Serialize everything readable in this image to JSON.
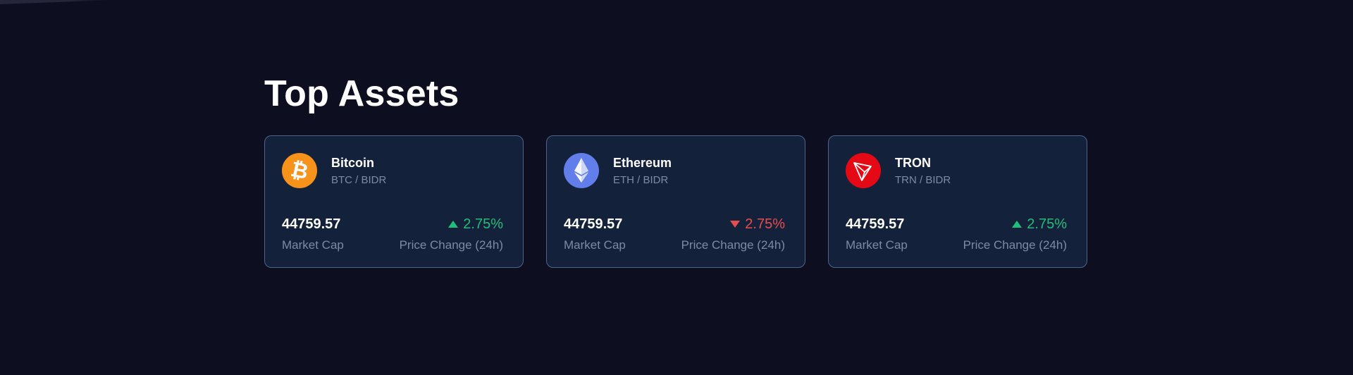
{
  "section": {
    "title": "Top Assets"
  },
  "assets": [
    {
      "name": "Bitcoin",
      "pair": "BTC / BIDR",
      "price": "44759.57",
      "price_label": "Market Cap",
      "change": "2.75%",
      "change_direction": "up",
      "change_label": "Price Change (24h)",
      "icon": "bitcoin-icon",
      "icon_color": "#f7931a"
    },
    {
      "name": "Ethereum",
      "pair": "ETH / BIDR",
      "price": "44759.57",
      "price_label": "Market Cap",
      "change": "2.75%",
      "change_direction": "down",
      "change_label": "Price Change (24h)",
      "icon": "ethereum-icon",
      "icon_color": "#627eea"
    },
    {
      "name": "TRON",
      "pair": "TRN / BIDR",
      "price": "44759.57",
      "price_label": "Market Cap",
      "change": "2.75%",
      "change_direction": "up",
      "change_label": "Price Change (24h)",
      "icon": "tron-icon",
      "icon_color": "#e50915"
    }
  ],
  "colors": {
    "background": "#0d0e1f",
    "card_background": "#14213a",
    "card_border": "#4d6487",
    "positive": "#1fbf7a",
    "negative": "#e84d4d",
    "muted_text": "#7d8aa6"
  }
}
